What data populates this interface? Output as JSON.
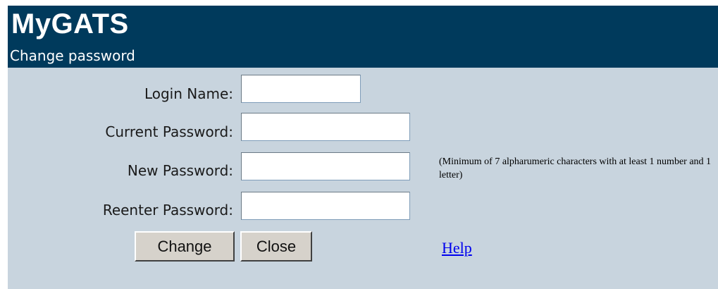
{
  "header": {
    "app_title": "MyGATS",
    "subtitle": "Change password"
  },
  "form": {
    "login_name": {
      "label": "Login Name:",
      "value": ""
    },
    "current_password": {
      "label": "Current Password:",
      "value": ""
    },
    "new_password": {
      "label": "New Password:",
      "value": ""
    },
    "reenter_password": {
      "label": "Reenter Password:",
      "value": ""
    },
    "password_hint": "(Minimum of 7 alpharumeric characters with at least 1 number and 1 letter)"
  },
  "buttons": {
    "change_label": "Change",
    "close_label": "Close"
  },
  "links": {
    "help_label": "Help"
  },
  "colors": {
    "header_bg": "#003a5c",
    "panel_bg": "#c8d4de",
    "link": "#0000ee"
  }
}
